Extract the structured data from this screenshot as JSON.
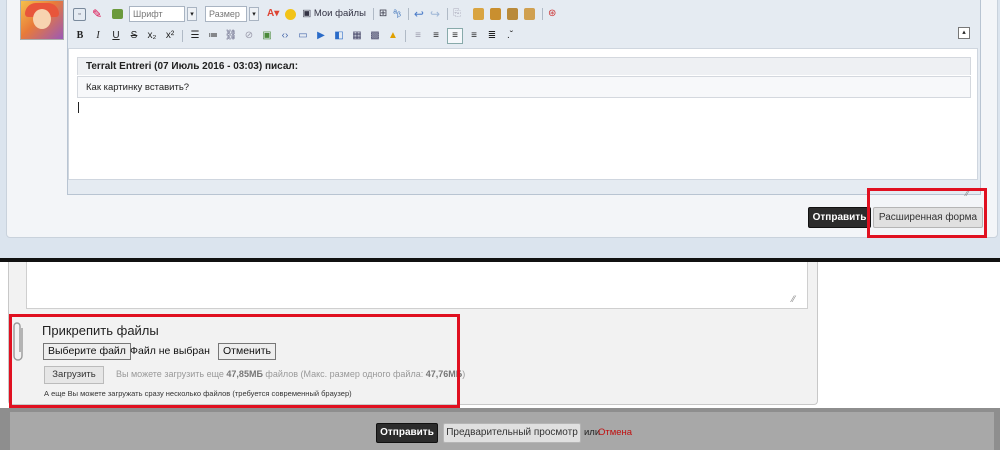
{
  "editor": {
    "font_select": "Шрифт",
    "size_select": "Размер",
    "my_files": "Мои файлы",
    "format_labels": [
      "B",
      "I",
      "U",
      "S",
      "x₂",
      "x²"
    ],
    "colors": {
      "accent": "#e01020",
      "toolbar_bg": "#e5ebf2",
      "quote_head": "#eef0f3"
    }
  },
  "quote": {
    "header": "Terralt Entreri (07 Июль 2016 - 03:03) писал:",
    "body": "Как картинку вставить?"
  },
  "top_buttons": {
    "send": "Отправить",
    "extended_form": "Расширенная форма"
  },
  "attachments": {
    "title": "Прикрепить файлы",
    "choose_file": "Выберите файл",
    "no_file": "Файл не выбран",
    "cancel": "Отменить",
    "upload": "Загрузить",
    "info_prefix": "Вы можете загрузить еще ",
    "info_remaining": "47,85МБ",
    "info_middle": " файлов (Макс. размер одного файла: ",
    "info_max": "47,76МБ",
    "info_suffix": ")",
    "multi_note": "А еще Вы можете загружать сразу несколько файлов (требуется современный браузер)"
  },
  "bottom_buttons": {
    "send": "Отправить",
    "preview": "Предварительный просмотр",
    "or": "или",
    "cancel": "Отмена"
  }
}
